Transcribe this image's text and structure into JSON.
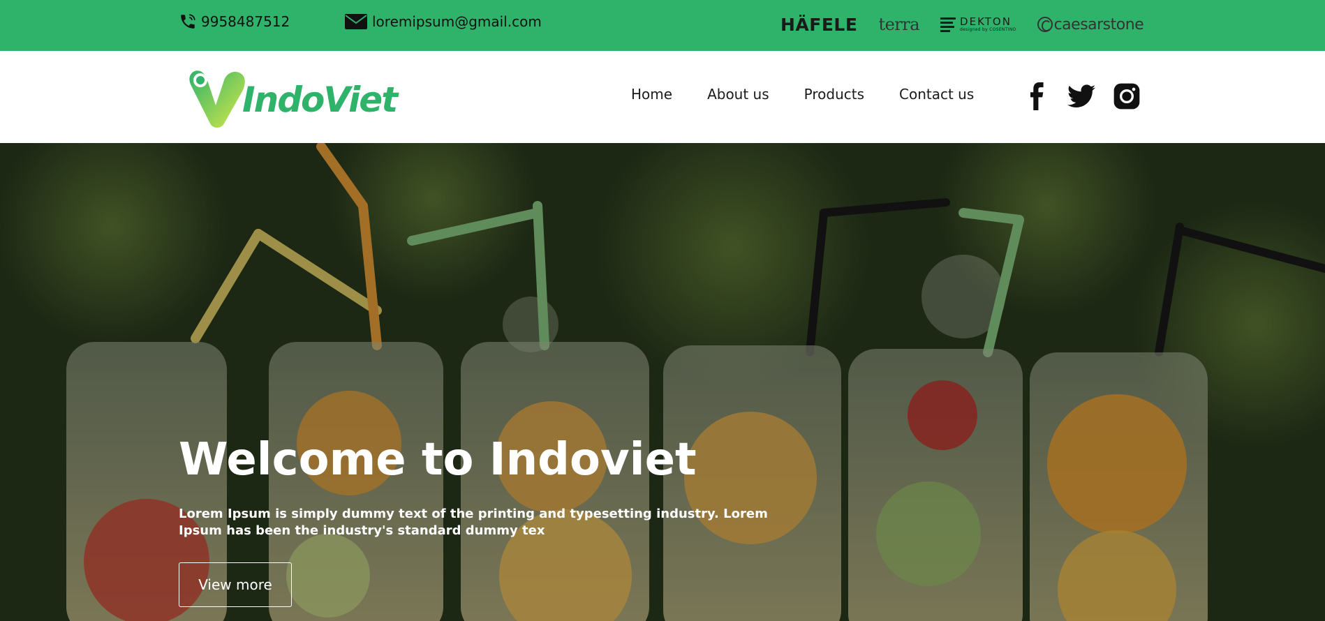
{
  "topbar": {
    "phone": "9958487512",
    "email": "loremipsum@gmail.com",
    "icons": {
      "phone": "phone-icon",
      "email": "envelope-icon"
    },
    "brands": {
      "hafele": "HÄFELE",
      "terra": "terra",
      "dekton": "DEKTON",
      "dekton_sub": "designed by COSENTINO",
      "caesarstone": "caesarstone"
    }
  },
  "navbar": {
    "logo_text": "IndoViet",
    "menu": [
      "Home",
      "About us",
      "Products",
      "Contact us"
    ],
    "social": [
      "facebook-icon",
      "twitter-icon",
      "instagram-icon"
    ]
  },
  "hero": {
    "title": "Welcome to Indoviet",
    "text": "Lorem Ipsum is simply dummy text of the printing and typesetting industry. Lorem Ipsum has been the industry's standard dummy tex",
    "button": "View more"
  },
  "colors": {
    "brand_green": "#2fb36a",
    "logo_lime": "#c9e34a",
    "text_dark": "#1a1a1a",
    "hero_text": "#ffffff"
  }
}
